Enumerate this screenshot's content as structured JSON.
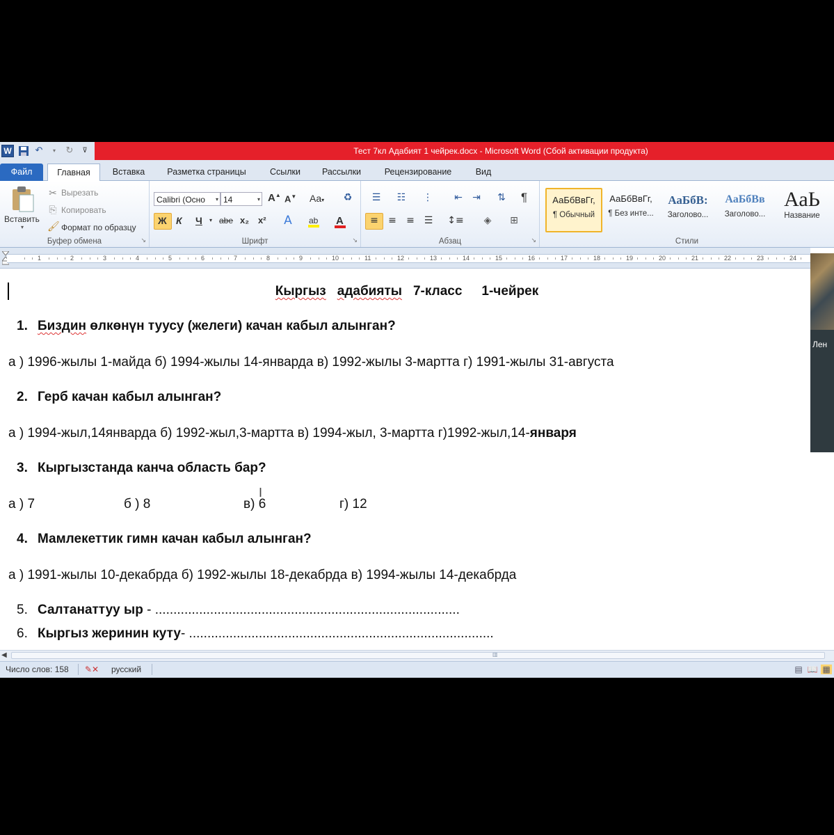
{
  "window": {
    "title": "Тест 7кл Адабият 1 чейрек.docx  -  Microsoft Word (Сбой активации продукта)"
  },
  "quick_access": {
    "icons": [
      "word-logo-icon",
      "save-icon",
      "undo-icon",
      "redo-icon",
      "customize-icon"
    ],
    "word_logo": "W"
  },
  "ribbon_tabs": [
    "Файл",
    "Главная",
    "Вставка",
    "Разметка страницы",
    "Ссылки",
    "Рассылки",
    "Рецензирование",
    "Вид"
  ],
  "clipboard": {
    "paste": "Вставить",
    "cut": "Вырезать",
    "copy": "Копировать",
    "format_painter": "Формат по образцу",
    "label": "Буфер обмена"
  },
  "font": {
    "family": "Calibri (Осно",
    "size": "14",
    "label": "Шрифт",
    "bold": "Ж",
    "italic": "К",
    "underline": "Ч",
    "strike": "abe",
    "subscript": "x₂",
    "superscript": "x²",
    "grow": "A",
    "shrink": "A",
    "change_case": "Aa",
    "font_color": "A"
  },
  "paragraph": {
    "label": "Абзац",
    "show_marks": "¶"
  },
  "styles": {
    "label": "Стили",
    "items": [
      {
        "sample": "АаБбВвГг,",
        "name": "¶ Обычный"
      },
      {
        "sample": "АаБбВвГг,",
        "name": "¶ Без инте..."
      },
      {
        "sample": "АаБбВ:",
        "name": "Заголово..."
      },
      {
        "sample": "АаБбВв",
        "name": "Заголово..."
      },
      {
        "sample": "АаЬ",
        "name": "Название"
      }
    ]
  },
  "ruler": {
    "numbers": [
      "1",
      "2",
      "3",
      "4",
      "5",
      "6",
      "7",
      "8",
      "9",
      "10",
      "11",
      "12",
      "13",
      "14",
      "15",
      "16",
      "17",
      "18",
      "19",
      "20",
      "21",
      "22",
      "23",
      "24"
    ]
  },
  "document": {
    "title_words": [
      "Кыргыз",
      "адабияты",
      "7-класс",
      "1-чейрек"
    ],
    "q1": {
      "num": "1.",
      "word1": "Биздин",
      "word2_pre": "өлкөнүн",
      "rest": "туусу (желеги) качан кабыл алынган?"
    },
    "a1": "а ) 1996-жылы 1-майда    б) 1994-жылы 14-январда   в) 1992-жылы 3-мартта  г) 1991-жылы 31-августа",
    "q2": {
      "num": "2.",
      "text": "Герб качан кабыл алынган?"
    },
    "a2": "а ) 1994-жыл,14январда   б) 1992-жыл,3-мартта   в) 1994-жыл, 3-мартта   г)1992-жыл,14-",
    "a2_bold": "января",
    "q3": {
      "num": "3.",
      "text": "Кыргызстанда канча область бар?"
    },
    "a3": [
      "а ) 7",
      "б ) 8",
      "в) 6",
      "г) 12"
    ],
    "q4": {
      "num": "4.",
      "text": "Мамлекеттик гимн качан кабыл алынган?"
    },
    "a4": "а ) 1991-жылы 10-декабрда   б) 1992-жылы 18-декабрда  в) 1994-жылы 14-декабрда",
    "q5": {
      "num": "5.",
      "text": "Салтанаттуу ыр",
      "fill": " - ..................................................................................."
    },
    "q6": {
      "num": "6.",
      "text": "Кыргыз жеринин куту",
      "fill": "- ..................................................................................."
    }
  },
  "video": {
    "name": "Лен"
  },
  "status": {
    "word_count": "Число слов: 158",
    "language": "русский"
  },
  "colors": {
    "titlebar": "#e5202a",
    "file_tab": "#2b6ac1",
    "ribbon": "#e6edf7",
    "highlight": "#fbd36f"
  }
}
